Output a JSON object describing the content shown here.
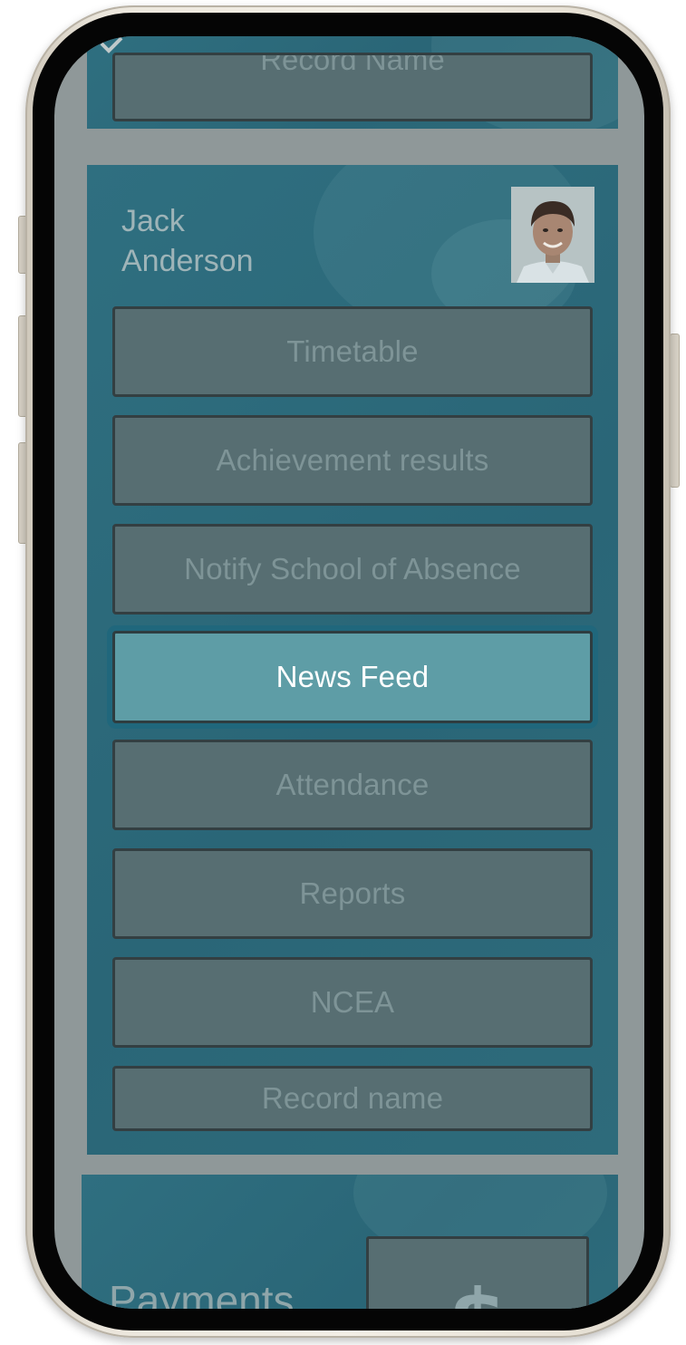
{
  "top_card": {
    "record_label": "Record Name"
  },
  "student": {
    "first_name": "Jack",
    "last_name": "Anderson",
    "avatar_icon": "student-avatar-photo"
  },
  "menu": {
    "items": [
      {
        "label": "Timetable",
        "active": false
      },
      {
        "label": "Achievement results",
        "active": false
      },
      {
        "label": "Notify School of Absence",
        "active": false
      },
      {
        "label": "News Feed",
        "active": true
      },
      {
        "label": "Attendance",
        "active": false
      },
      {
        "label": "Reports",
        "active": false
      },
      {
        "label": "NCEA",
        "active": false
      },
      {
        "label": "Record name",
        "active": false
      }
    ]
  },
  "payments": {
    "label": "Payments",
    "icon_symbol": "$",
    "icon": "dollar-icon"
  },
  "colors": {
    "card": "#2a6677",
    "button": "#576e72",
    "button_text": "#7e9497",
    "active_button": "#5e9da6",
    "active_text": "#ffffff",
    "overlay": "#8f9899"
  }
}
